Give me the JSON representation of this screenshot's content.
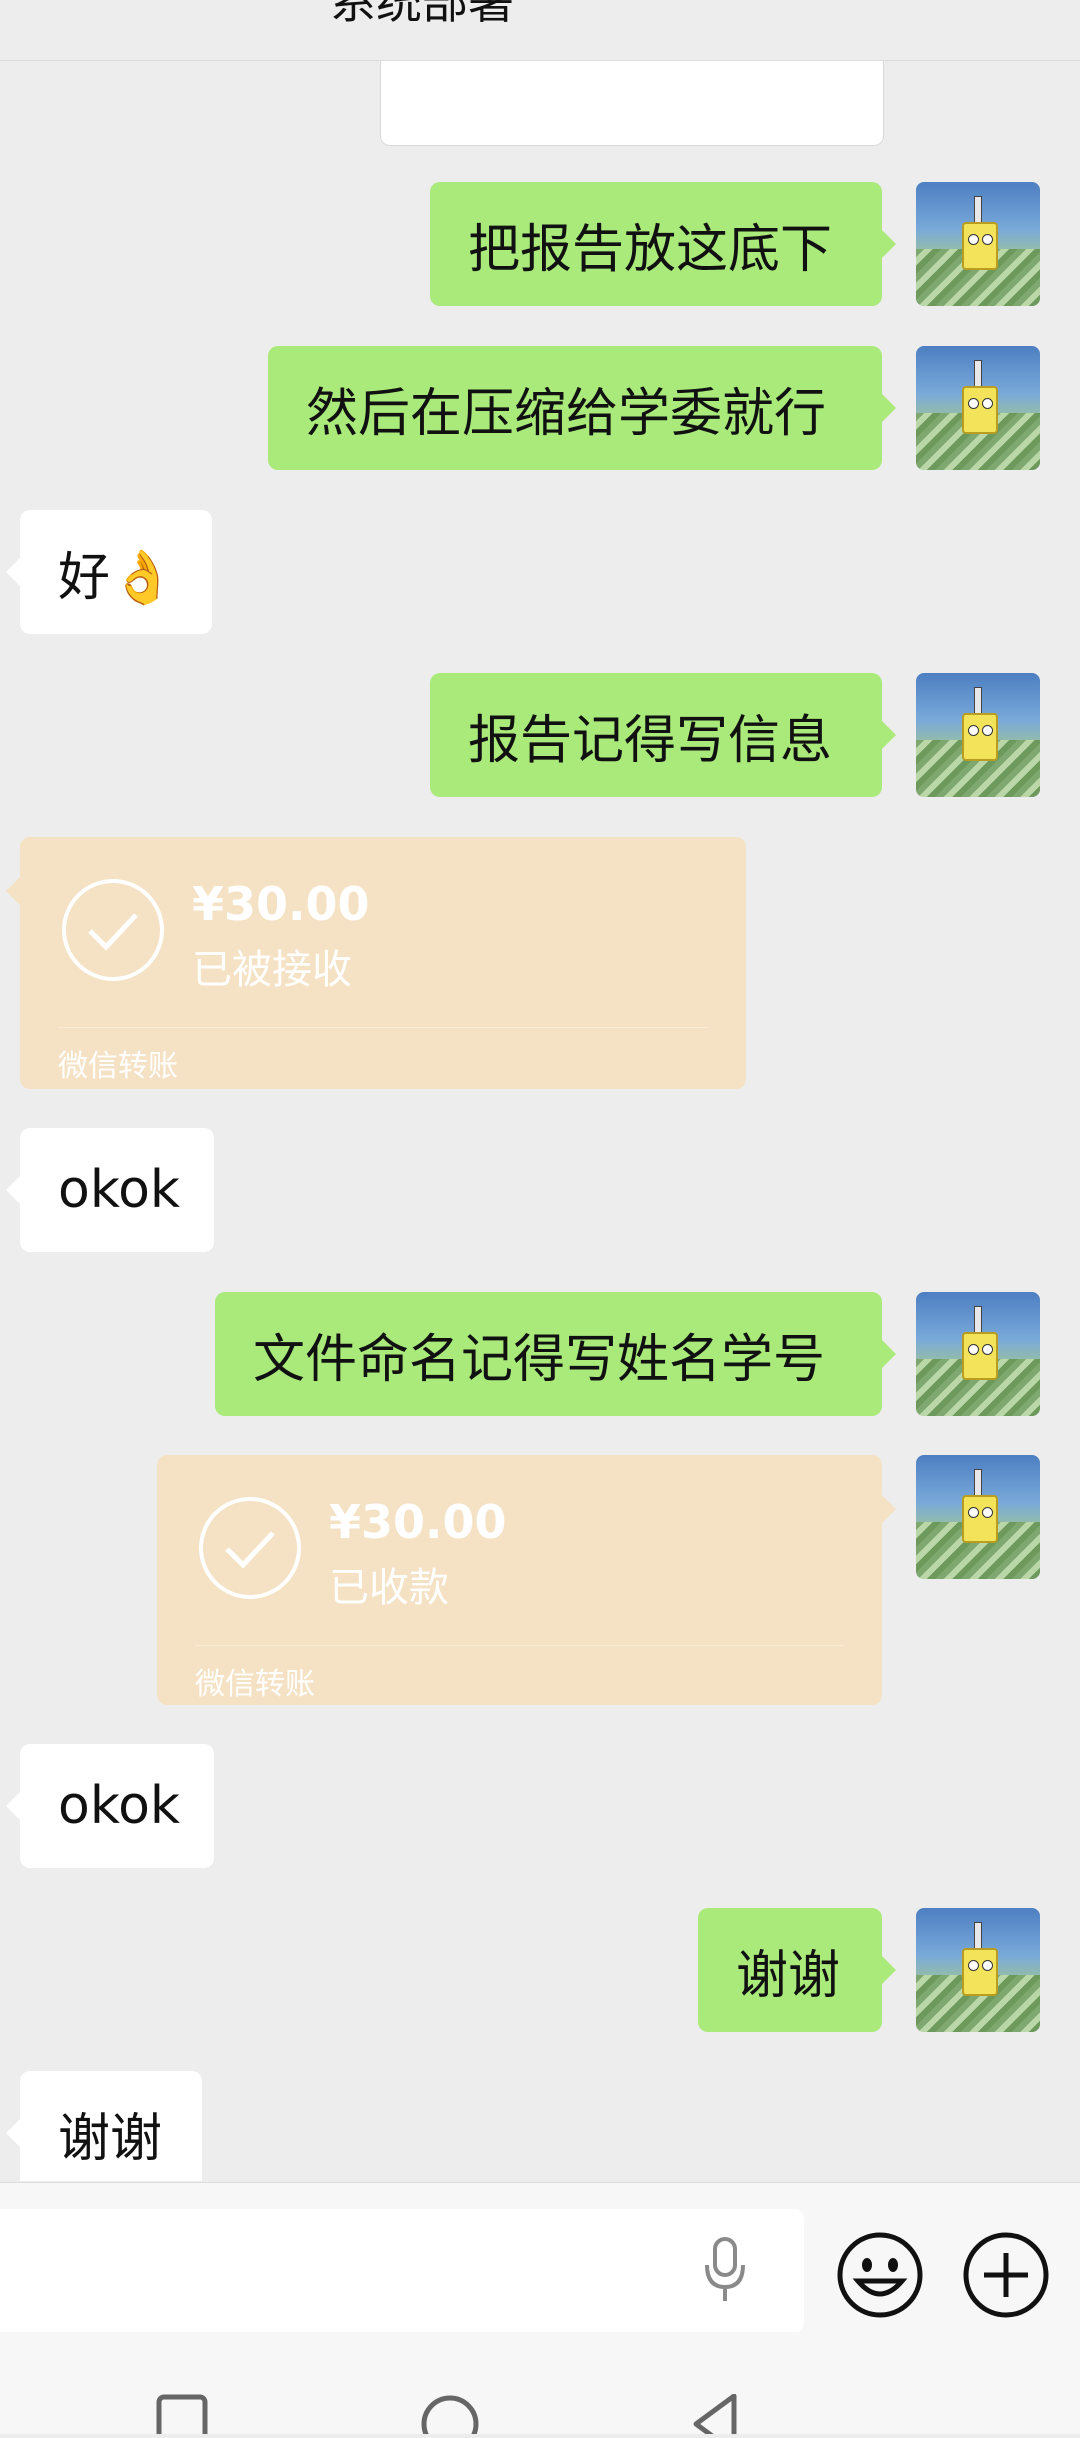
{
  "header": {
    "title": "系统部署"
  },
  "messages": [
    {
      "side": "me",
      "type": "text",
      "text": "把报告放这底下"
    },
    {
      "side": "me",
      "type": "text",
      "text": "然后在压缩给学委就行"
    },
    {
      "side": "them",
      "type": "text",
      "text": "好👌"
    },
    {
      "side": "me",
      "type": "text",
      "text": "报告记得写信息"
    },
    {
      "side": "them",
      "type": "transfer",
      "amount": "¥30.00",
      "status": "已被接收",
      "source": "微信转账"
    },
    {
      "side": "them",
      "type": "text",
      "text": "okok"
    },
    {
      "side": "me",
      "type": "text",
      "text": "文件命名记得写姓名学号"
    },
    {
      "side": "me",
      "type": "transfer",
      "amount": "¥30.00",
      "status": "已收款",
      "source": "微信转账"
    },
    {
      "side": "them",
      "type": "text",
      "text": "okok"
    },
    {
      "side": "me",
      "type": "text",
      "text": "谢谢"
    },
    {
      "side": "them",
      "type": "text",
      "text": "谢谢"
    }
  ],
  "input": {
    "icons": [
      "microphone-icon",
      "emoji-icon",
      "plus-icon"
    ]
  },
  "navbar": {
    "icons": [
      "recent-apps-icon",
      "home-icon",
      "back-icon"
    ]
  },
  "colors": {
    "my_bubble": "#a9ea7a",
    "their_bubble": "#ffffff",
    "transfer_card": "#f5e2c5",
    "background": "#ededed"
  }
}
